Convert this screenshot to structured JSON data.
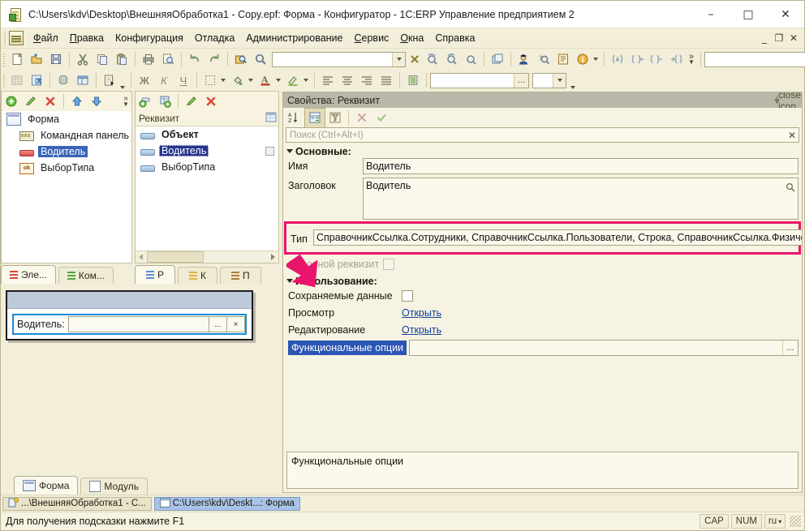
{
  "window": {
    "title": "C:\\Users\\kdv\\Desktop\\ВнешняяОбработка1 - Copy.epf: Форма - Конфигуратор - 1С:ERP Управление предприятием 2",
    "app_icon": "1c-document-icon",
    "minimize": "–",
    "maximize": "□",
    "close": "✕"
  },
  "menubar": {
    "items": [
      {
        "label": "Файл",
        "accel": "Ф"
      },
      {
        "label": "Правка",
        "accel": "П"
      },
      {
        "label": "Конфигурация",
        "accel": "К"
      },
      {
        "label": "Отладка",
        "accel": "О"
      },
      {
        "label": "Администрирование",
        "accel": "А"
      },
      {
        "label": "Сервис",
        "accel": "С"
      },
      {
        "label": "Окна",
        "accel": "О"
      },
      {
        "label": "Справка",
        "accel": "п"
      }
    ],
    "mdi_minimize": "_",
    "mdi_restore": "❐",
    "mdi_close": "✕"
  },
  "toolbar": {
    "row1": [
      {
        "name": "new-icon",
        "tip": "Новый"
      },
      {
        "name": "open-icon",
        "tip": "Открыть"
      },
      {
        "name": "save-icon",
        "tip": "Сохранить"
      },
      {
        "name": "cut-icon",
        "tip": "Вырезать"
      },
      {
        "name": "copy-icon",
        "tip": "Копировать"
      },
      {
        "name": "paste-icon",
        "tip": "Вставить"
      },
      {
        "name": "print-icon",
        "tip": "Печать"
      },
      {
        "name": "print-preview-icon",
        "tip": "Предварительный просмотр"
      },
      {
        "name": "undo-icon",
        "tip": "Отменить"
      },
      {
        "name": "redo-icon",
        "tip": "Вернуть"
      },
      {
        "name": "find-in-files-icon",
        "tip": "Глобальный поиск"
      },
      {
        "name": "find-icon",
        "tip": "Найти"
      }
    ],
    "search_combo_value": "",
    "row1b": [
      {
        "name": "find-next-icon"
      },
      {
        "name": "find-prev-icon"
      },
      {
        "name": "find-all-icon"
      },
      {
        "name": "windows-icon"
      },
      {
        "name": "user-icon"
      },
      {
        "name": "syntax-help-icon"
      },
      {
        "name": "config-check-icon"
      },
      {
        "name": "info-icon"
      },
      {
        "name": "step-into-icon"
      },
      {
        "name": "step-over-icon"
      },
      {
        "name": "step-out-icon"
      },
      {
        "name": "run-to-cursor-icon"
      },
      {
        "name": "overflow-chevron-icon",
        "label": "»"
      }
    ],
    "combo2_value": "",
    "row2": [
      {
        "name": "grid-icon"
      },
      {
        "name": "excel-export-icon"
      },
      {
        "name": "db-icon"
      },
      {
        "name": "table-icon"
      },
      {
        "name": "doc-run-icon"
      },
      {
        "name": "bold-icon",
        "label": "Ж"
      },
      {
        "name": "italic-icon",
        "label": "К"
      },
      {
        "name": "underline-icon",
        "label": "Ч"
      },
      {
        "name": "borders-icon"
      },
      {
        "name": "fill-color-icon"
      },
      {
        "name": "font-color-icon"
      },
      {
        "name": "highlight-color-icon"
      },
      {
        "name": "align-left-icon"
      },
      {
        "name": "align-center-icon"
      },
      {
        "name": "align-right-icon"
      },
      {
        "name": "align-justify-icon"
      },
      {
        "name": "clipboard-green-icon"
      }
    ],
    "field_value": "",
    "field_dots": "...",
    "small_combo_value": ""
  },
  "elements_pane": {
    "toolbar": [
      {
        "name": "add-element-icon"
      },
      {
        "name": "edit-element-icon"
      },
      {
        "name": "delete-element-icon"
      },
      {
        "name": "move-up-icon"
      },
      {
        "name": "move-down-icon"
      },
      {
        "name": "more-icon",
        "label": "»"
      }
    ],
    "tree": [
      {
        "label": "Форма",
        "icon": "form-icon",
        "level": 0,
        "selected": false,
        "bold": false
      },
      {
        "label": "Командная панель",
        "icon": "command-panel-icon",
        "level": 1,
        "selected": false,
        "bold": false
      },
      {
        "label": "Водитель",
        "icon": "attribute-field-icon",
        "level": 1,
        "selected": true,
        "bold": false
      },
      {
        "label": "ВыборТипа",
        "icon": "ok-button-icon",
        "level": 1,
        "selected": false,
        "bold": false
      }
    ]
  },
  "attributes_pane": {
    "toolbar": [
      {
        "name": "add-attribute-icon"
      },
      {
        "name": "add-table-icon"
      },
      {
        "name": "edit-attribute-icon"
      },
      {
        "name": "delete-attribute-icon"
      }
    ],
    "column_header": "Реквизит",
    "header_icon": "column-settings-icon",
    "tree": [
      {
        "label": "Объект",
        "level": 0,
        "bold": true,
        "selected": false,
        "checkbox": false
      },
      {
        "label": "Водитель",
        "level": 0,
        "bold": false,
        "selected": true,
        "checkbox": true
      },
      {
        "label": "ВыборТипа",
        "level": 0,
        "bold": false,
        "selected": false,
        "checkbox": false
      }
    ]
  },
  "left_tabs": [
    {
      "label": "Эле...",
      "color": "#d84a3a",
      "active": true,
      "name": "tab-elements"
    },
    {
      "label": "Ком...",
      "color": "#4aa83a",
      "active": false,
      "name": "tab-commands"
    }
  ],
  "attr_tabs": [
    {
      "label": "Р",
      "color": "#5a8fd0",
      "active": true,
      "name": "tab-attributes"
    },
    {
      "label": "К",
      "color": "#e0b33a",
      "active": false,
      "name": "tab-commands-attr"
    },
    {
      "label": "П",
      "color": "#b07a3a",
      "active": false,
      "name": "tab-parameters"
    }
  ],
  "form_preview": {
    "field_label": "Водитель:",
    "field_value": "",
    "select_button": "...",
    "clear_button": "×"
  },
  "bottom_tabs": [
    {
      "label": "Форма",
      "icon": "form-icon",
      "active": true,
      "name": "tab-form"
    },
    {
      "label": "Модуль",
      "icon": "module-icon",
      "active": false,
      "name": "tab-module"
    }
  ],
  "properties": {
    "title": "Свойства: Реквизит",
    "pin_icon": "pin-icon",
    "close_icon": "close-icon",
    "toolbar": [
      {
        "name": "sort-az-icon",
        "label": "A↓Z"
      },
      {
        "name": "group-by-category-icon"
      },
      {
        "name": "filter-icon"
      },
      {
        "name": "cancel-icon",
        "label": "✕"
      },
      {
        "name": "apply-icon",
        "label": "✓"
      }
    ],
    "search_placeholder": "Поиск (Ctrl+Alt+I)",
    "search_value": "",
    "search_clear": "✕",
    "group_basic": "Основные:",
    "group_usage": "Использование:",
    "rows": {
      "name_label": "Имя",
      "name_value": "Водитель",
      "title_label": "Заголовок",
      "title_value": "Водитель",
      "title_search_icon": "magnifier-icon",
      "type_label": "Тип",
      "type_value": "СправочникСсылка.Сотрудники, СправочникСсылка.Пользователи, Строка, СправочникСсылка.ФизическиеЛица",
      "type_dots": "...",
      "main_attr_label": "Основной реквизит",
      "main_attr_checked": false,
      "saved_data_label": "Сохраняемые данные",
      "saved_data_checked": false,
      "view_label": "Просмотр",
      "view_link": "Открыть",
      "edit_label": "Редактирование",
      "edit_link": "Открыть",
      "func_options_label": "Функциональные опции",
      "func_options_value": "",
      "func_options_dots": "..."
    },
    "description": "Функциональные опции"
  },
  "annotation": {
    "arrow_color": "#e8156b",
    "highlight_color": "#e8156b"
  },
  "taskbar": {
    "items": [
      {
        "label": "...\\ВнешняяОбработка1 - С...",
        "icon": "epf-icon",
        "active": false,
        "name": "taskbar-item-processor"
      },
      {
        "label": "C:\\Users\\kdv\\Deskt...: Форма",
        "icon": "form-window-icon",
        "active": true,
        "name": "taskbar-item-form"
      }
    ]
  },
  "statusbar": {
    "message": "Для получения подсказки нажмите F1",
    "cells": [
      "CAP",
      "NUM"
    ],
    "language": "ru",
    "language_caret": "▾"
  }
}
